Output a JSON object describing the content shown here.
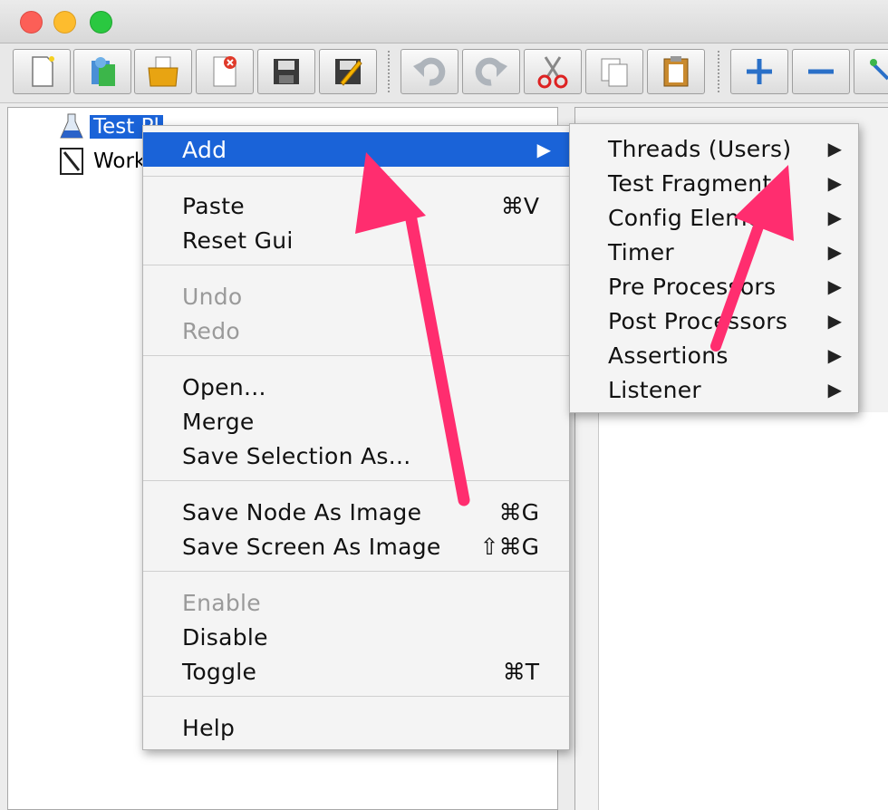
{
  "window": {
    "controls": [
      "close",
      "minimize",
      "zoom"
    ]
  },
  "toolbar": {
    "buttons": [
      {
        "name": "new-icon"
      },
      {
        "name": "templates-icon"
      },
      {
        "name": "open-icon"
      },
      {
        "name": "close-icon"
      },
      {
        "name": "save-icon"
      },
      {
        "name": "save-as-icon"
      },
      {
        "name": "undo-icon"
      },
      {
        "name": "redo-icon"
      },
      {
        "name": "cut-icon"
      },
      {
        "name": "copy-icon"
      },
      {
        "name": "paste-icon"
      },
      {
        "name": "expand-icon"
      },
      {
        "name": "collapse-icon"
      },
      {
        "name": "toggle-icon"
      }
    ]
  },
  "tree": {
    "items": [
      {
        "label": "Test Pl",
        "icon": "test-plan-icon",
        "selected": true
      },
      {
        "label": "Work",
        "icon": "workbench-icon",
        "selected": false
      }
    ]
  },
  "context_menu": {
    "add": {
      "label": "Add",
      "arrow": "▶"
    },
    "paste": {
      "label": "Paste",
      "shortcut": "⌘V"
    },
    "reset_gui": {
      "label": "Reset Gui"
    },
    "undo": {
      "label": "Undo"
    },
    "redo": {
      "label": "Redo"
    },
    "open": {
      "label": "Open..."
    },
    "merge": {
      "label": "Merge"
    },
    "save_selection": {
      "label": "Save Selection As..."
    },
    "save_node_image": {
      "label": "Save Node As Image",
      "shortcut": "⌘G"
    },
    "save_screen_image": {
      "label": "Save Screen As Image",
      "shortcut": "⇧⌘G"
    },
    "enable": {
      "label": "Enable"
    },
    "disable": {
      "label": "Disable"
    },
    "toggle": {
      "label": "Toggle",
      "shortcut": "⌘T"
    },
    "help": {
      "label": "Help"
    }
  },
  "submenu": {
    "items": [
      {
        "label": "Threads (Users)",
        "arrow": "▶"
      },
      {
        "label": "Test Fragment",
        "arrow": "▶"
      },
      {
        "label": "Config Element",
        "arrow": "▶"
      },
      {
        "label": "Timer",
        "arrow": "▶"
      },
      {
        "label": "Pre Processors",
        "arrow": "▶"
      },
      {
        "label": "Post Processors",
        "arrow": "▶"
      },
      {
        "label": "Assertions",
        "arrow": "▶"
      },
      {
        "label": "Listener",
        "arrow": "▶"
      }
    ]
  },
  "colors": {
    "selection": "#1a63d8",
    "annotation_arrow": "#ff2d6f"
  }
}
